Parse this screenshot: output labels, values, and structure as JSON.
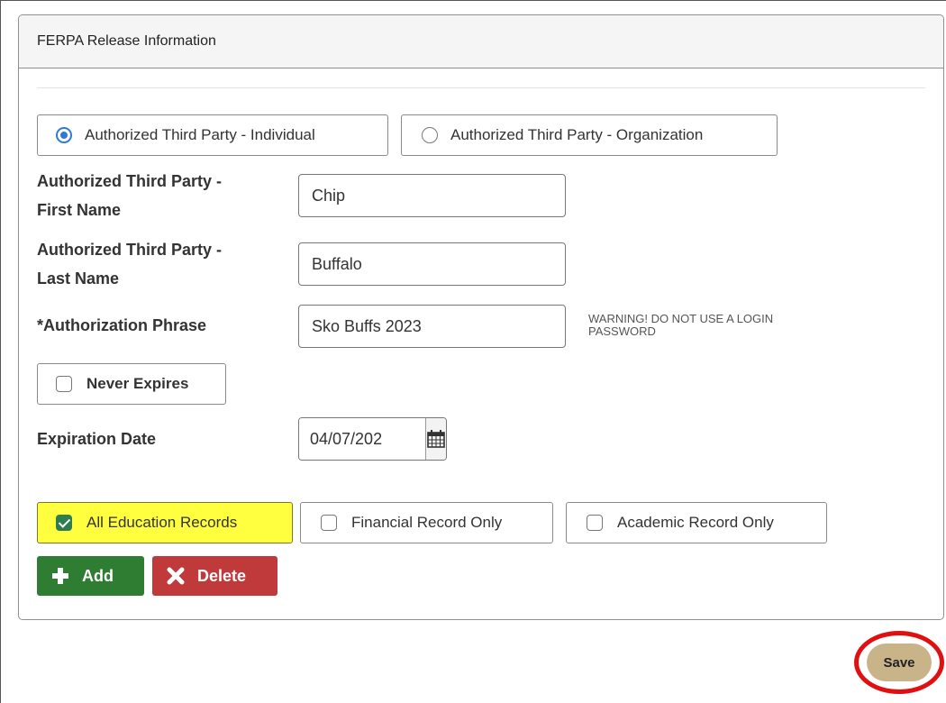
{
  "panel": {
    "title": "FERPA Release Information"
  },
  "party_type": {
    "individual_label": "Authorized Third Party - Individual",
    "organization_label": "Authorized Third Party - Organization",
    "selected": "individual"
  },
  "fields": {
    "first_name_label_line1": "Authorized Third Party -",
    "first_name_label_line2": "First Name",
    "first_name_value": "Chip",
    "last_name_label_line1": "Authorized Third Party -",
    "last_name_label_line2": "Last Name",
    "last_name_value": "Buffalo",
    "phrase_label": "*Authorization Phrase",
    "phrase_value": "Sko Buffs 2023",
    "phrase_warning_line1": "WARNING! DO NOT USE A LOGIN",
    "phrase_warning_line2": "PASSWORD"
  },
  "never_expires": {
    "label": "Never Expires",
    "checked": false
  },
  "expiration": {
    "label": "Expiration Date",
    "value": "04/07/202",
    "icon": "calendar-icon"
  },
  "records": {
    "all_label": "All Education Records",
    "financial_label": "Financial Record Only",
    "academic_label": "Academic Record Only",
    "all_checked": true,
    "highlight_color": "#ffff40"
  },
  "actions": {
    "add_label": "Add",
    "delete_label": "Delete",
    "add_color": "#2e7d32",
    "delete_color": "#c0393b"
  },
  "footer": {
    "save_label": "Save",
    "save_color": "#c9b48a",
    "highlight_ring": "#e01010"
  }
}
